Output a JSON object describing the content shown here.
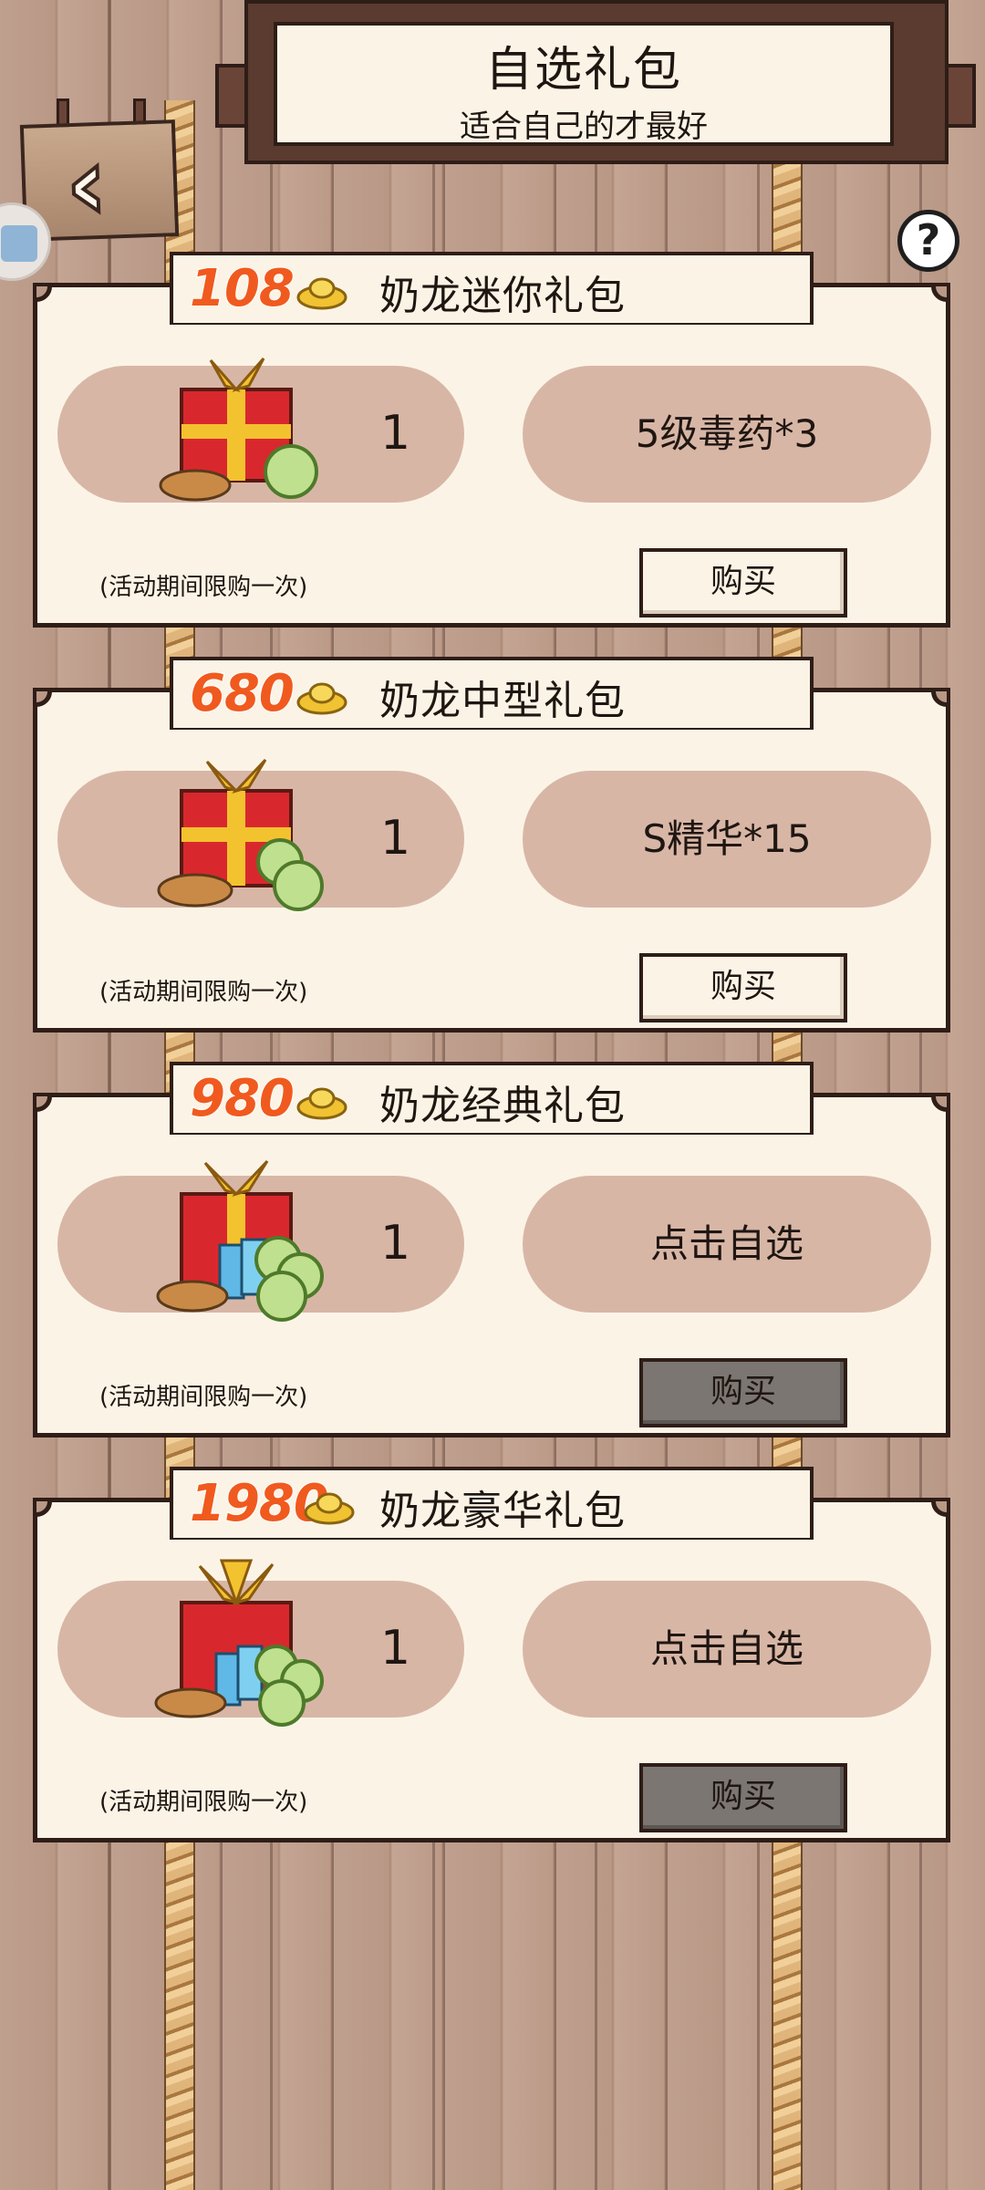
{
  "header": {
    "title": "自选礼包",
    "subtitle": "适合自己的才最好"
  },
  "help": {
    "label": "?"
  },
  "packs": [
    {
      "price": "108",
      "name": "奶龙迷你礼包",
      "quantity": "1",
      "reward": "5级毒药*3",
      "limit_note": "(活动期间限购一次)",
      "buy_label": "购买",
      "buy_enabled": true
    },
    {
      "price": "680",
      "name": "奶龙中型礼包",
      "quantity": "1",
      "reward": "S精华*15",
      "limit_note": "(活动期间限购一次)",
      "buy_label": "购买",
      "buy_enabled": true
    },
    {
      "price": "980",
      "name": "奶龙经典礼包",
      "quantity": "1",
      "reward": "点击自选",
      "limit_note": "(活动期间限购一次)",
      "buy_label": "购买",
      "buy_enabled": false
    },
    {
      "price": "1980",
      "name": "奶龙豪华礼包",
      "quantity": "1",
      "reward": "点击自选",
      "limit_note": "(活动期间限购一次)",
      "buy_label": "购买",
      "buy_enabled": false
    }
  ],
  "colors": {
    "price": "#f05a1e",
    "card_bg": "#fbf4e6",
    "bubble": "#d8b6a6",
    "button_disabled": "#7b7671",
    "frame": "#2f1d17"
  }
}
